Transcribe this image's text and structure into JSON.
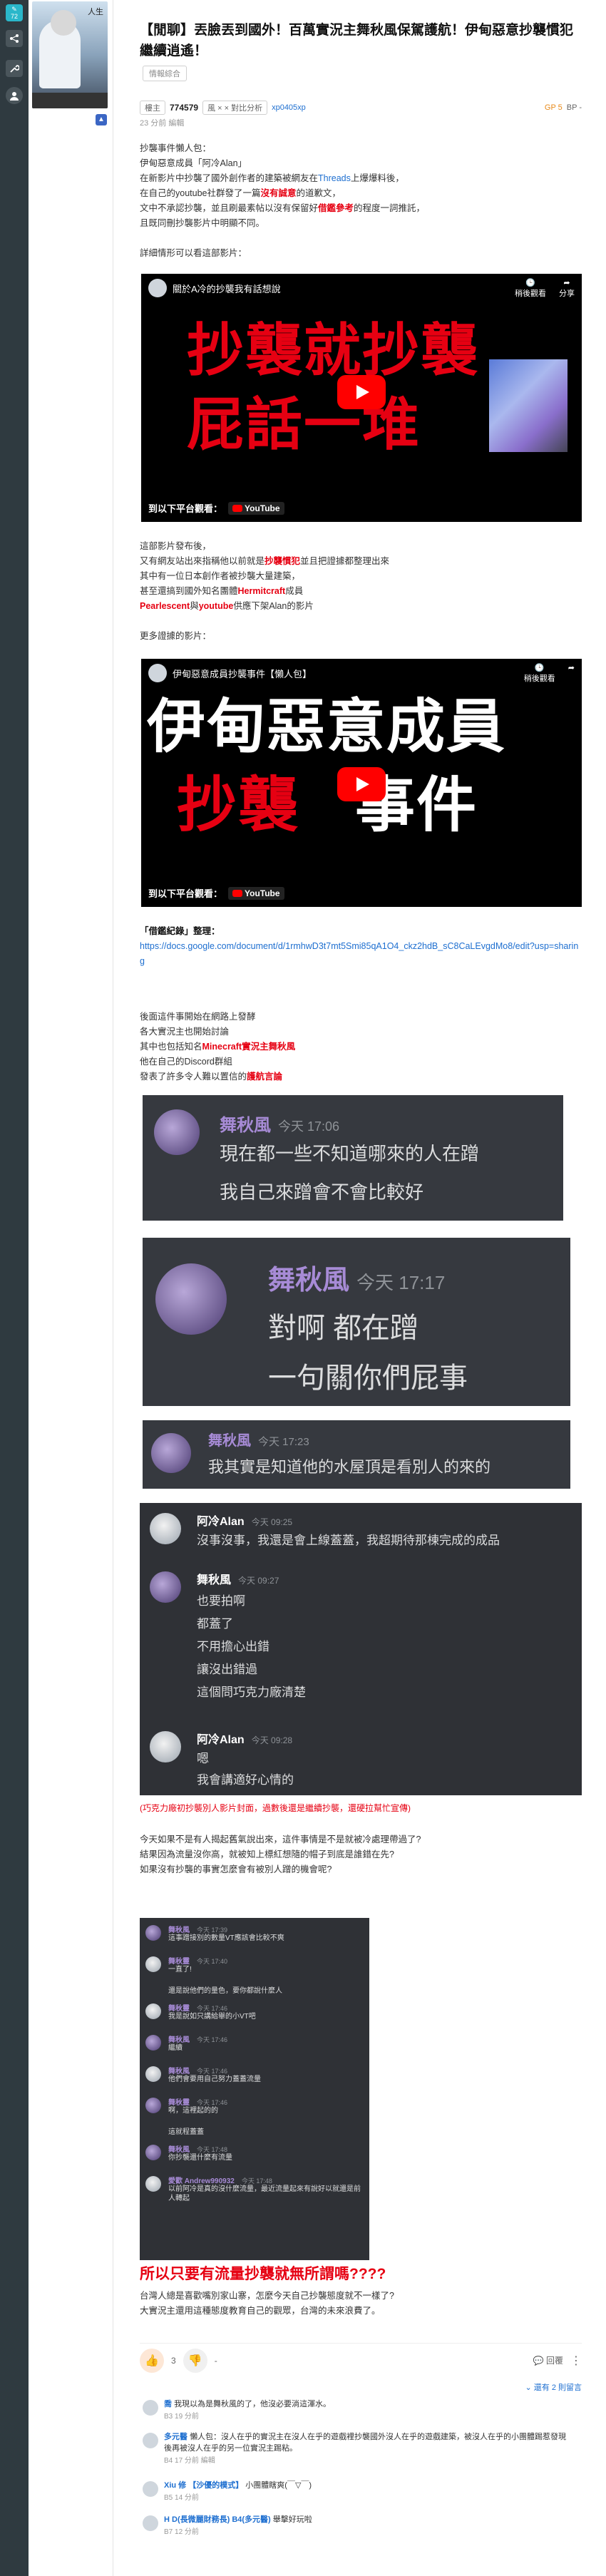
{
  "sidebar": {
    "reply_count": "72",
    "icons": [
      "home-icon",
      "share-icon",
      "tools-icon",
      "profile-icon"
    ]
  },
  "thumb": {
    "label": "人生"
  },
  "post": {
    "title": "【閒聊】丟臉丟到國外！百萬實況主舞秋風保駕護航！伊甸惡意抄襲慣犯繼續逍遙！",
    "tag": "情報綜合",
    "floor": "774579",
    "badge": "風 × × 對比分析",
    "author": "xp0405xp",
    "time": "23 分前 編輯",
    "gp": "GP 5",
    "bp": "BP -"
  },
  "intro": [
    "抄襲事件懶人包：",
    "伊甸惡意成員「阿冷Alan」",
    "在新影片中抄襲了國外創作者的建築被網友在Threads上爆爆料後，",
    "在自己的youtube社群發了一篇沒有誠意的道歉文，",
    "文中不承認抄襲，並且刷最素帖以沒有保留好借鑑參考的程度一詞推託，",
    "且既同刪抄襲影片中明顯不同。",
    "",
    "詳細情形可以看這部影片："
  ],
  "video1": {
    "title": "關於A冷的抄襲我有話想說",
    "watch_later": "稍後觀看",
    "share": "分享",
    "line1": "抄襲就抄襲",
    "line2": "屁話一堆",
    "watch_on": "到以下平台觀看：",
    "yt": "YouTube"
  },
  "para2": [
    "這部影片發布後，",
    "又有網友站出來指稱他以前就是抄襲慣犯並且把證據都整理出來",
    "其中有一位日本創作者被抄襲大量建築，",
    "甚至還搞到國外知名團體Hermitcraft成員",
    "Pearlescent與youtube供應下架Alan的影片",
    "",
    "更多證據的影片："
  ],
  "video2": {
    "title": "伊甸惡意成員抄襲事件【懶人包】",
    "watch_later": "稍後觀看",
    "line1": "伊甸惡意成員",
    "line2a": "抄襲",
    "line2b": "事件",
    "watch_on": "到以下平台觀看：",
    "yt": "YouTube"
  },
  "doc": {
    "label": "「借鑑紀錄」整理：",
    "url": "https://docs.google.com/document/d/1rmhwD3t7mt5Smi85qA1O4_ckz2hdB_sC8CaLEvgdMo8/edit?usp=sharing"
  },
  "para3": [
    "後面這件事開始在網路上發酵",
    "各大實況主也開始討論",
    "其中也包括知名Minecraft實況主舞秋風",
    "他在自己的Discord群組",
    "發表了許多令人難以置信的護航言論"
  ],
  "disc1": {
    "name": "舞秋風",
    "time": "今天 17:06",
    "l1": "現在都一些不知道哪來的人在蹭",
    "l2": "我自己來蹭會不會比較好"
  },
  "disc2": {
    "name": "舞秋風",
    "time": "今天 17:17",
    "l1": "對啊 都在蹭",
    "l2": "一句關你們屁事"
  },
  "disc3": {
    "name": "舞秋風",
    "time": "今天 17:23",
    "l1": "我其實是知道他的水屋頂是看別人的來的"
  },
  "disc4": {
    "a_name": "阿冷Alan",
    "a_time": "今天 09:25",
    "a_msg": "沒事沒事，我還是會上線蓋蓋，我超期待那棟完成的成品",
    "b_name": "舞秋風",
    "b_time": "今天 09:27",
    "b_msgs": [
      "也要拍啊",
      "都蓋了",
      "不用擔心出錯",
      "讓沒出錯過",
      "這個問巧克力廠清楚"
    ],
    "c_name": "阿冷Alan",
    "c_time": "今天 09:28",
    "c_msgs": [
      "嗯",
      "我會講適好心情的"
    ]
  },
  "caption_red": "(巧克力廠初抄襲別人影片封面，過數後還是繼續抄襲，還硬拉幫忙宣傳)",
  "para4": [
    "今天如果不是有人揭起舊氣說出來，這件事情是不是就被冷處理帶過了?",
    "結果因為流量沒你高，就被知上標紅想隨的帽子到底是誰錯在先?",
    "如果沒有抄襲的事實怎麼會有被別人蹭的機會呢?"
  ],
  "disc5": {
    "rows": [
      {
        "name": "舞秋風",
        "time": "今天 17:39",
        "msg": "這事蹭接別的數量VT應該會比較不爽"
      },
      {
        "name": "舞秋靈",
        "time": "今天 17:40",
        "msg": "一直了!"
      },
      {
        "name": "",
        "time": "",
        "msg": "還是說他們的量色，要你都說什麼人"
      },
      {
        "name": "舞秋靈",
        "time": "今天 17:46",
        "msg": "我是說如只講給舉的小VT吧"
      },
      {
        "name": "舞秋風",
        "time": "今天 17:46",
        "msg": "繼續"
      },
      {
        "name": "舞秋風",
        "time": "今天 17:46",
        "msg": "他們會要用自己努力蓋蓋流量"
      },
      {
        "name": "舞秋靈",
        "time": "今天 17:46",
        "msg": "啊，這裡起的的"
      },
      {
        "name": "",
        "time": "",
        "msg": "這就程蓋蓋"
      },
      {
        "name": "舞秋風",
        "time": "今天 17:48",
        "msg": "你抄襲還什麼有流量"
      },
      {
        "name": "愛歡 Andrew990932",
        "time": "今天 17:48",
        "msg": "以前阿冷是真的沒什麼流量，最近流量起來有說好以就還是前人轉起"
      }
    ]
  },
  "big_red": "所以只要有流量抄襲就無所謂嗎????",
  "para5": [
    "台灣人總是喜歡嘴別家山寨，怎麼今天自己抄襲態度就不一樣了?",
    "大實況主還用這種態度教育自己的觀眾，台灣的未來浪費了。"
  ],
  "actions": {
    "like_count": "3",
    "dislike": "-",
    "reply_btn": "回覆",
    "more": "⋮",
    "view_replies": "還有 2 則留言"
  },
  "replies": [
    {
      "name": "喬",
      "msg": "我現以為是舞秋風的了，他沒必要淌這渾水。",
      "meta": "B3 19 分前"
    },
    {
      "name": "多元醫",
      "msg": "懶人包：沒人在乎的實況主在沒人在乎的遊戲裡抄襲國外沒人在乎的遊戲建築，被沒人在乎的小團體踢惹發現後再被沒人在乎的另一位實況主踢粘。",
      "meta": "B4 17 分前 編輯"
    },
    {
      "name": "Xiu 修 【沙優的模式】",
      "msg": "小團體瞎爽(￣▽￣)",
      "meta": "B5 14 分前"
    },
    {
      "name": "H D(長微麗財務長) B4(多元醫)",
      "msg": "舉擊好玩啦",
      "meta": "B7 12 分前"
    }
  ],
  "colors": {
    "red": "#e60012",
    "blue": "#1e6fd0",
    "discord_bg": "#36393f",
    "sidebar": "#2f3a40",
    "accent": "#2ab7ca"
  }
}
